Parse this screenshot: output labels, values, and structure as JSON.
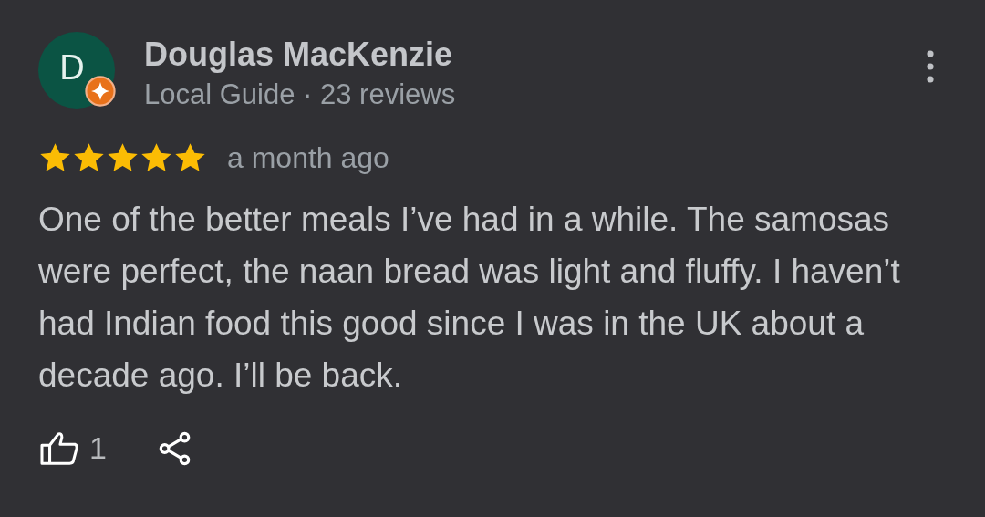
{
  "review": {
    "avatar_letter": "D",
    "author": "Douglas MacKenzie",
    "author_meta": "Local Guide · 23 reviews",
    "stars": 5,
    "time": "a month ago",
    "text": "One of the better meals I’ve had in a while. The samosas were perfect, the naan bread was light and fluffy. I haven’t had Indian food this good since I was in the UK about a decade ago. I’ll be back.",
    "likes": "1"
  }
}
